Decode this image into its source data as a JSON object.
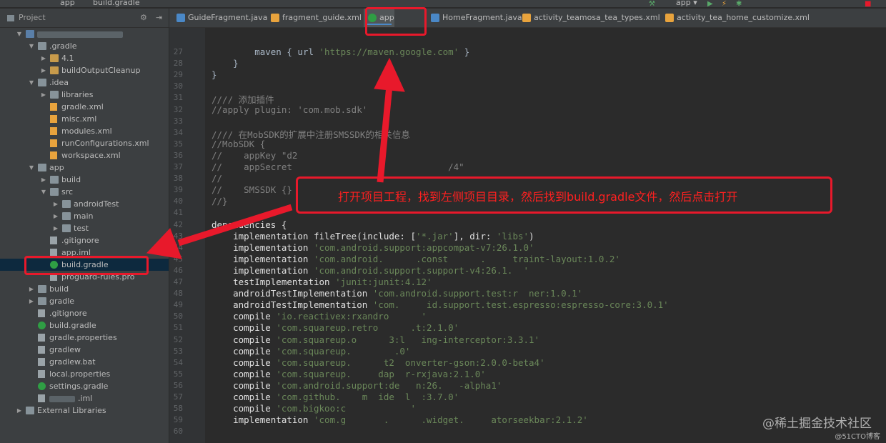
{
  "topbar": {
    "crumb_app": "app",
    "crumb_file": "build.gradle",
    "config_label": "app ▾"
  },
  "tabs": [
    {
      "label": "GuideFragment.java",
      "color": "#4a88c7"
    },
    {
      "label": "fragment_guide.xml",
      "color": "#e8a33d"
    },
    {
      "label": "app",
      "color": "#2f9e44",
      "active": true
    },
    {
      "label": "HomeFragment.java",
      "color": "#4a88c7"
    },
    {
      "label": "activity_teamosa_tea_types.xml",
      "color": "#e8a33d"
    },
    {
      "label": "activity_tea_home_customize.xml",
      "color": "#e8a33d"
    }
  ],
  "sidebar": {
    "title": "Project",
    "tree": [
      {
        "label": "",
        "blurred": true,
        "level": 0,
        "type": "folder-blue",
        "expanded": true
      },
      {
        "label": ".gradle",
        "level": 1,
        "type": "folder",
        "expanded": true
      },
      {
        "label": "4.1",
        "level": 2,
        "type": "folder-orange",
        "expanded": false
      },
      {
        "label": "buildOutputCleanup",
        "level": 2,
        "type": "folder-orange",
        "expanded": false
      },
      {
        "label": ".idea",
        "level": 1,
        "type": "folder",
        "expanded": true
      },
      {
        "label": "libraries",
        "level": 2,
        "type": "folder",
        "expanded": false
      },
      {
        "label": "gradle.xml",
        "level": 2,
        "type": "xml"
      },
      {
        "label": "misc.xml",
        "level": 2,
        "type": "xml"
      },
      {
        "label": "modules.xml",
        "level": 2,
        "type": "xml"
      },
      {
        "label": "runConfigurations.xml",
        "level": 2,
        "type": "xml"
      },
      {
        "label": "workspace.xml",
        "level": 2,
        "type": "xml"
      },
      {
        "label": "app",
        "level": 1,
        "type": "folder",
        "expanded": true
      },
      {
        "label": "build",
        "level": 2,
        "type": "folder",
        "expanded": false
      },
      {
        "label": "src",
        "level": 2,
        "type": "folder",
        "expanded": true
      },
      {
        "label": "androidTest",
        "level": 3,
        "type": "folder",
        "expanded": false
      },
      {
        "label": "main",
        "level": 3,
        "type": "folder",
        "expanded": false
      },
      {
        "label": "test",
        "level": 3,
        "type": "folder",
        "expanded": false
      },
      {
        "label": ".gitignore",
        "level": 2,
        "type": "plain"
      },
      {
        "label": "app.iml",
        "level": 2,
        "type": "plain"
      },
      {
        "label": "build.gradle",
        "level": 2,
        "type": "gradle",
        "selected": true
      },
      {
        "label": "proguard-rules.pro",
        "level": 2,
        "type": "plain"
      },
      {
        "label": "build",
        "level": 1,
        "type": "folder",
        "expanded": false
      },
      {
        "label": "gradle",
        "level": 1,
        "type": "folder",
        "expanded": false
      },
      {
        "label": ".gitignore",
        "level": 1,
        "type": "plain"
      },
      {
        "label": "build.gradle",
        "level": 1,
        "type": "gradle"
      },
      {
        "label": "gradle.properties",
        "level": 1,
        "type": "plain"
      },
      {
        "label": "gradlew",
        "level": 1,
        "type": "plain"
      },
      {
        "label": "gradlew.bat",
        "level": 1,
        "type": "plain"
      },
      {
        "label": "local.properties",
        "level": 1,
        "type": "plain"
      },
      {
        "label": "settings.gradle",
        "level": 1,
        "type": "gradle"
      },
      {
        "label": ".iml",
        "level": 1,
        "type": "plain",
        "blurred_prefix": true
      },
      {
        "label": "External Libraries",
        "level": 0,
        "type": "folder",
        "expanded": false
      }
    ]
  },
  "editor": {
    "lines": [
      {
        "num": "27",
        "segments": [
          {
            "t": "        maven { ",
            "c": ""
          },
          {
            "t": "url ",
            "c": ""
          },
          {
            "t": "'https://maven.google.com'",
            "c": "str"
          },
          {
            "t": " }",
            "c": ""
          }
        ]
      },
      {
        "num": "28",
        "segments": [
          {
            "t": "    }",
            "c": ""
          }
        ]
      },
      {
        "num": "29",
        "segments": [
          {
            "t": "}",
            "c": ""
          }
        ]
      },
      {
        "num": "30",
        "segments": []
      },
      {
        "num": "31",
        "segments": [
          {
            "t": "//// 添加插件",
            "c": "comment"
          }
        ]
      },
      {
        "num": "32",
        "segments": [
          {
            "t": "//apply plugin: 'com.mob.sdk'",
            "c": "comment"
          }
        ]
      },
      {
        "num": "33",
        "segments": []
      },
      {
        "num": "34",
        "segments": [
          {
            "t": "//// 在MobSDK的扩展中注册SMSSDK的相关信息",
            "c": "comment"
          }
        ]
      },
      {
        "num": "35",
        "segments": [
          {
            "t": "//MobSDK {",
            "c": "comment"
          }
        ]
      },
      {
        "num": "36",
        "segments": [
          {
            "t": "//    appKey \"d2",
            "c": "comment"
          }
        ]
      },
      {
        "num": "37",
        "segments": [
          {
            "t": "//    appSecret",
            "c": "comment"
          },
          {
            "t": "                             /4\"",
            "c": "comment"
          }
        ]
      },
      {
        "num": "38",
        "segments": [
          {
            "t": "//",
            "c": "comment"
          }
        ]
      },
      {
        "num": "39",
        "segments": [
          {
            "t": "//    SMSSDK {}",
            "c": "comment"
          }
        ]
      },
      {
        "num": "40",
        "segments": [
          {
            "t": "//}",
            "c": "comment"
          }
        ]
      },
      {
        "num": "41",
        "segments": []
      },
      {
        "num": "42",
        "segments": [
          {
            "t": "dependencies {",
            "c": "white"
          }
        ]
      },
      {
        "num": "43",
        "segments": [
          {
            "t": "    implementation ",
            "c": "white"
          },
          {
            "t": "fileTree(include: [",
            "c": "white"
          },
          {
            "t": "'*.jar'",
            "c": "str"
          },
          {
            "t": "], dir: ",
            "c": "white"
          },
          {
            "t": "'libs'",
            "c": "str"
          },
          {
            "t": ")",
            "c": "white"
          }
        ]
      },
      {
        "num": "44",
        "segments": [
          {
            "t": "    implementation ",
            "c": "white"
          },
          {
            "t": "'com.android.support:appcompat-v7:26.1.0'",
            "c": "str"
          }
        ]
      },
      {
        "num": "45",
        "segments": [
          {
            "t": "    implementation ",
            "c": "white"
          },
          {
            "t": "'com.android.      .const      .     traint-layout:1.0.2'",
            "c": "str"
          }
        ]
      },
      {
        "num": "46",
        "segments": [
          {
            "t": "    implementation ",
            "c": "white"
          },
          {
            "t": "'com.android.support.support-v4:26.1.  '",
            "c": "str"
          }
        ]
      },
      {
        "num": "47",
        "segments": [
          {
            "t": "    testImplementation ",
            "c": "white"
          },
          {
            "t": "'junit:junit:4.12'",
            "c": "str"
          }
        ]
      },
      {
        "num": "48",
        "segments": [
          {
            "t": "    androidTestImplementation ",
            "c": "white"
          },
          {
            "t": "'com.android.support.test:r  ner:1.0.1'",
            "c": "str"
          }
        ]
      },
      {
        "num": "49",
        "segments": [
          {
            "t": "    androidTestImplementation ",
            "c": "white"
          },
          {
            "t": "'com.     id.support.test.espresso:espresso-core:3.0.1'",
            "c": "str"
          }
        ]
      },
      {
        "num": "50",
        "segments": [
          {
            "t": "    compile ",
            "c": "white"
          },
          {
            "t": "'io.reactivex:rxandro      '",
            "c": "str"
          }
        ]
      },
      {
        "num": "51",
        "segments": [
          {
            "t": "    compile ",
            "c": "white"
          },
          {
            "t": "'com.squareup.retro      .t:2.1.0'",
            "c": "str"
          }
        ]
      },
      {
        "num": "52",
        "segments": [
          {
            "t": "    compile ",
            "c": "white"
          },
          {
            "t": "'com.squareup.o      3:l   ing-interceptor:3.3.1'",
            "c": "str"
          }
        ]
      },
      {
        "num": "53",
        "segments": [
          {
            "t": "    compile ",
            "c": "white"
          },
          {
            "t": "'com.squareup.        .0'",
            "c": "str"
          }
        ]
      },
      {
        "num": "54",
        "segments": [
          {
            "t": "    compile ",
            "c": "white"
          },
          {
            "t": "'com.squareup.      t2  onverter-gson:2.0.0-beta4'",
            "c": "str"
          }
        ]
      },
      {
        "num": "55",
        "segments": [
          {
            "t": "    compile ",
            "c": "white"
          },
          {
            "t": "'com.squareup.     dap  r-rxjava:2.1.0'",
            "c": "str"
          }
        ]
      },
      {
        "num": "56",
        "segments": [
          {
            "t": "    compile ",
            "c": "white"
          },
          {
            "t": "'com.android.support:de   n:26.   -alpha1'",
            "c": "str"
          }
        ]
      },
      {
        "num": "57",
        "segments": [
          {
            "t": "    compile ",
            "c": "white"
          },
          {
            "t": "'com.github.    m  ide  l  :3.7.0'",
            "c": "str"
          }
        ]
      },
      {
        "num": "58",
        "segments": [
          {
            "t": "    compile ",
            "c": "white"
          },
          {
            "t": "'com.bigkoo:c            '",
            "c": "str"
          }
        ]
      },
      {
        "num": "59",
        "segments": [
          {
            "t": "    implementation ",
            "c": "white"
          },
          {
            "t": "'com.g       .      .widget.     atorseekbar:2.1.2'",
            "c": "str"
          }
        ]
      },
      {
        "num": "60",
        "segments": []
      }
    ]
  },
  "annotation": {
    "callout_text": "打开项目工程，找到左侧项目目录，然后找到build.gradle文件，然后点击打开",
    "accent_color": "#e8192b"
  },
  "watermark": {
    "main": "@稀土掘金技术社区",
    "sub": "@51CTO博客"
  }
}
